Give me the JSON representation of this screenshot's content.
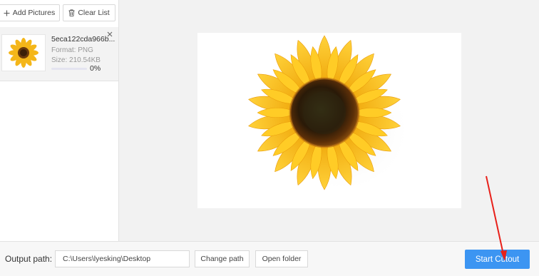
{
  "toolbar": {
    "add_label": "Add Pictures",
    "clear_label": "Clear List"
  },
  "file_list": [
    {
      "name": "5eca122cda966b...",
      "format_label": "Format:",
      "format": "PNG",
      "size_label": "Size:",
      "size": "210.54KB",
      "progress_percent": 0,
      "progress_text": "0%"
    }
  ],
  "bottom": {
    "output_label": "Output path:",
    "output_path": "C:\\Users\\lyesking\\Desktop",
    "change_path_label": "Change path",
    "open_folder_label": "Open folder",
    "start_label": "Start Cutout"
  },
  "icons": {
    "add": "plus-icon",
    "clear": "trash-icon",
    "remove": "close-icon"
  },
  "colors": {
    "accent": "#3c95f2",
    "annotation_arrow": "#e8201a"
  }
}
